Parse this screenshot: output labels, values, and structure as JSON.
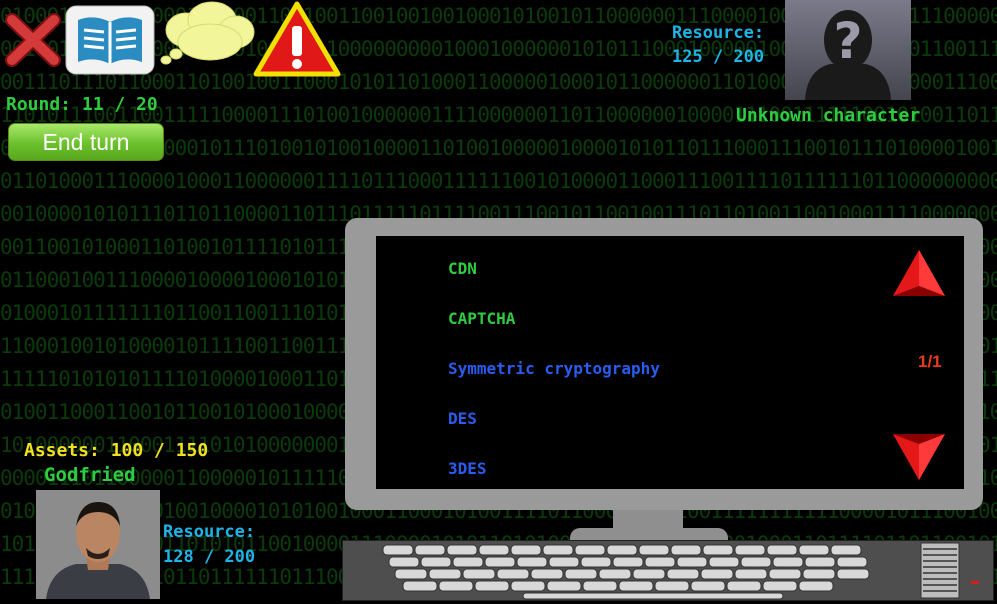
{
  "hud": {
    "round": "Round: 11 / 20",
    "end_turn": "End turn",
    "assets": "Assets: 100 / 150"
  },
  "opponent": {
    "resource_label": "Resource:",
    "resource_value": "125 / 200",
    "name": "Unknown character"
  },
  "player": {
    "name": "Godfried",
    "resource_label": "Resource:",
    "resource_value": "128 / 200"
  },
  "terminal": {
    "items": [
      {
        "label": "CDN",
        "color": "#2ecc40"
      },
      {
        "label": "CAPTCHA",
        "color": "#2ecc40"
      },
      {
        "label": "Symmetric cryptography",
        "color": "#2a5cf0"
      },
      {
        "label": "DES",
        "color": "#2a5cf0"
      },
      {
        "label": "3DES",
        "color": "#2a5cf0"
      }
    ],
    "page": "1/1"
  },
  "icons": [
    "close-icon",
    "book-icon",
    "thought-cloud-icon",
    "warning-icon",
    "scroll-up-icon",
    "scroll-down-icon"
  ],
  "colors": {
    "accent_green": "#2ecc40",
    "resource_blue": "#1eb4e6",
    "assets_yellow": "#f0e020",
    "alert_red": "#e83a1a"
  }
}
